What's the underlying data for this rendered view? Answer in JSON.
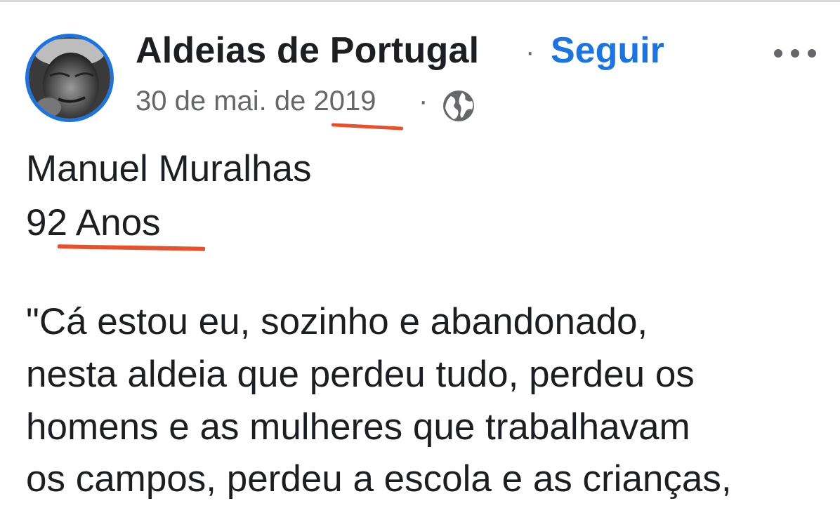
{
  "post": {
    "page_name": "Aldeias de Portugal",
    "separator": "·",
    "follow_label": "Seguir",
    "date": "30 de mai. de 2019",
    "meta_separator": "·",
    "audience_icon": "globe-icon",
    "more_icon": "more-options-icon",
    "avatar_icon": "profile-photo"
  },
  "content": {
    "lines": [
      "Manuel Muralhas",
      "92 Anos",
      "\"Cá estou eu, sozinho e abandonado,",
      "nesta aldeia que perdeu tudo, perdeu os",
      "homens e as mulheres que trabalhavam",
      "os campos, perdeu a escola e as crianças,"
    ]
  },
  "colors": {
    "accent": "#1b74e4",
    "text": "#1c1e21",
    "secondary_text": "#65676b",
    "annotation": "#e8502c"
  }
}
